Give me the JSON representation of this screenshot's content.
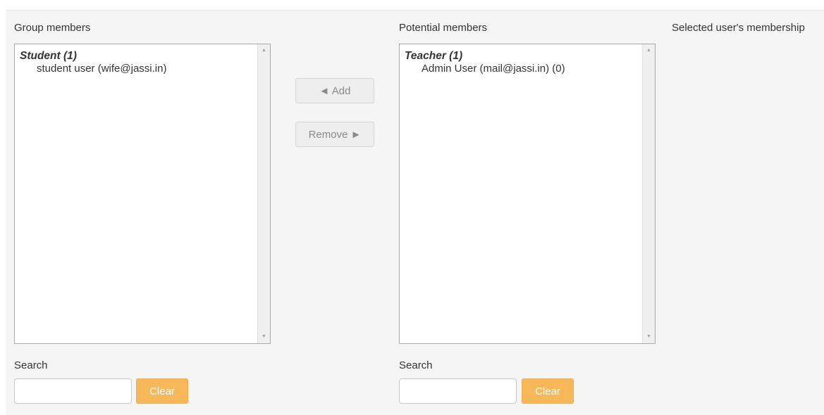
{
  "group_members": {
    "heading": "Group members",
    "groups": [
      {
        "label": "Student (1)",
        "options": [
          "student user (wife@jassi.in)"
        ]
      }
    ],
    "search_label": "Search",
    "search_value": "",
    "clear_label": "Clear"
  },
  "actions": {
    "add_label": "◄ Add",
    "remove_label": "Remove ►"
  },
  "potential_members": {
    "heading": "Potential members",
    "groups": [
      {
        "label": "Teacher (1)",
        "options": [
          "Admin User (mail@jassi.in) (0)"
        ]
      }
    ],
    "search_label": "Search",
    "search_value": "",
    "clear_label": "Clear"
  },
  "membership": {
    "heading": "Selected user's membership"
  },
  "colors": {
    "panel_bg": "#f5f5f5",
    "clear_button": "#f7b85a",
    "move_button": "#eeeeee"
  }
}
